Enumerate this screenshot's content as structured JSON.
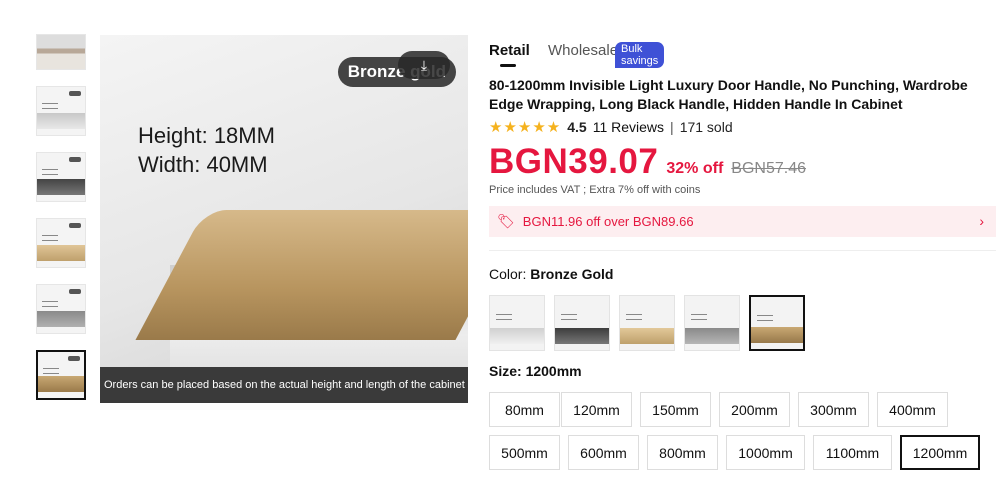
{
  "thumbnails": [
    {
      "name": "thumb-1"
    },
    {
      "name": "thumb-2"
    },
    {
      "name": "thumb-3"
    },
    {
      "name": "thumb-4"
    },
    {
      "name": "thumb-5"
    },
    {
      "name": "thumb-6"
    }
  ],
  "main_image": {
    "dimension_height": "Height: 18MM",
    "dimension_width": "Width: 40MM",
    "badge": "Bronze gold",
    "caption": "Orders can be placed based on the actual height and length of the cabinet door"
  },
  "tabs": {
    "retail": "Retail",
    "wholesale": "Wholesale",
    "bulk_badge": "Bulk savings"
  },
  "product": {
    "title": "80-1200mm Invisible Light Luxury Door Handle, No Punching, Wardrobe Edge Wrapping, Long Black Handle, Hidden Handle In Cabinet",
    "rating": "4.5",
    "reviews": "11 Reviews",
    "sold": "171 sold",
    "price": "BGN39.07",
    "discount": "32% off",
    "old_price": "BGN57.46",
    "vat_note": "Price includes VAT ; Extra 7% off with coins",
    "coupon": "BGN11.96 off over BGN89.66"
  },
  "color": {
    "label": "Color:",
    "selected": "Bronze Gold",
    "options": [
      "white",
      "black",
      "gold",
      "grey",
      "bronze-gold"
    ]
  },
  "size": {
    "label": "Size:",
    "selected": "1200mm",
    "options": [
      "80mm",
      "120mm",
      "150mm",
      "200mm",
      "300mm",
      "400mm",
      "500mm",
      "600mm",
      "800mm",
      "1000mm",
      "1100mm",
      "1200mm"
    ]
  },
  "colors": {
    "accent_red": "#e5173f",
    "bulk_blue": "#3f51d6",
    "star": "#f5b21e"
  }
}
